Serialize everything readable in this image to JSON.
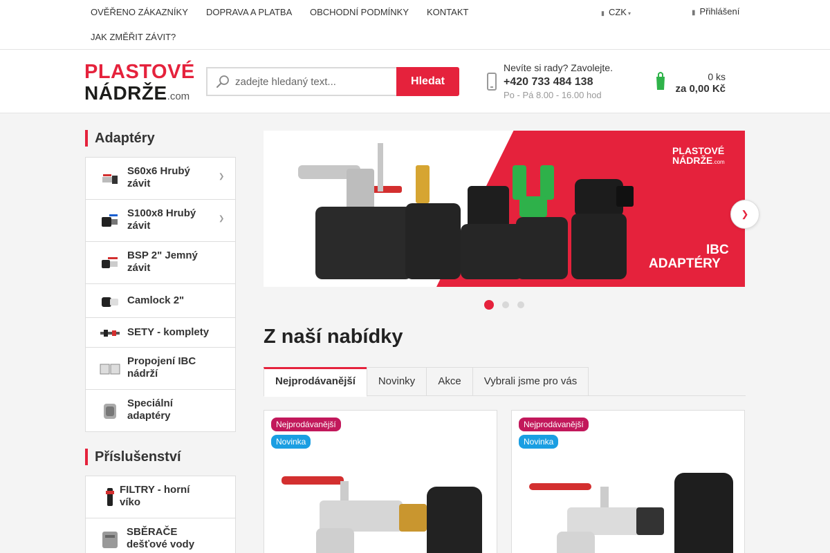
{
  "topnav": {
    "links": [
      "OVĚŘENO ZÁKAZNÍKY",
      "DOPRAVA A PLATBA",
      "OBCHODNÍ PODMÍNKY",
      "KONTAKT",
      "JAK ZMĚŘIT ZÁVIT?"
    ],
    "currency": "CZK",
    "login": "Přihlášení"
  },
  "logo": {
    "line1": "PLASTOVÉ",
    "line2": "NÁDRŽE",
    "domain": ".com"
  },
  "search": {
    "placeholder": "zadejte hledaný text...",
    "button": "Hledat"
  },
  "contact": {
    "prompt": "Nevíte si rady? Zavolejte.",
    "phone": "+420 733 484 138",
    "hours": "Po - Pá 8.00 - 16.00 hod"
  },
  "cart": {
    "qty": "0 ks",
    "total": "za 0,00 Kč"
  },
  "sidebar": {
    "adapters_title": "Adaptéry",
    "adapters": [
      {
        "label_1": "S60x6 Hrubý",
        "label_2": "závit",
        "has_arrow": true
      },
      {
        "label_1": "S100x8 Hrubý",
        "label_2": "závit",
        "has_arrow": true
      },
      {
        "label_1": "BSP 2\" Jemný",
        "label_2": "závit",
        "has_arrow": false
      },
      {
        "label_1": "Camlock 2\"",
        "label_2": "",
        "has_arrow": false
      },
      {
        "label_1": "SETY - komplety",
        "label_2": "",
        "has_arrow": false
      },
      {
        "label_1": "Propojení IBC",
        "label_2": "nádrží",
        "has_arrow": false
      },
      {
        "label_1": "Speciální",
        "label_2": "adaptéry",
        "has_arrow": false
      }
    ],
    "accessories_title": "Příslušenství",
    "accessories": [
      {
        "label_1": "FILTRY - horní",
        "label_2": "víko"
      },
      {
        "label_1": "SBĚRAČE",
        "label_2": "dešťové vody"
      }
    ]
  },
  "banner": {
    "logo_line1": "PLASTOVÉ",
    "logo_line2": "NÁDRŽE",
    "logo_domain": ".com",
    "caption_1": "IBC",
    "caption_2": "ADAPTÉRY",
    "slides": 3,
    "active_slide": 1
  },
  "offer": {
    "title": "Z naší nabídky",
    "tabs": [
      "Nejprodávanější",
      "Novinky",
      "Akce",
      "Vybrali jsme pro vás"
    ],
    "active_tab": "Nejprodávanější"
  },
  "products": [
    {
      "flag_best": "Nejprodávanější",
      "flag_new": "Novinka"
    },
    {
      "flag_best": "Nejprodávanější",
      "flag_new": "Novinka"
    }
  ],
  "colors": {
    "accent": "#e5223c",
    "flag_best": "#c2185b",
    "flag_new": "#1a9ee2"
  },
  "icons": {
    "currency": "money-icon",
    "login": "user-icon",
    "search": "search-icon",
    "phone": "phone-icon",
    "cart": "cart-icon",
    "arrow": "chevron-right-icon"
  }
}
